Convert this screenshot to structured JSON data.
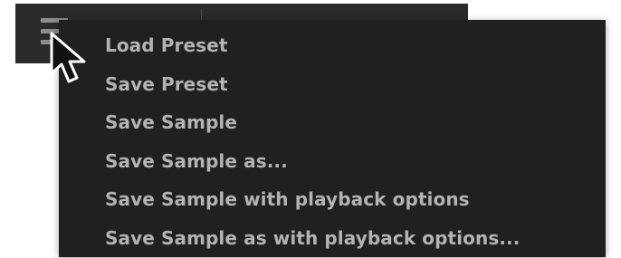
{
  "toolbar": {
    "menu_icon": "hamburger-menu-icon"
  },
  "menu": {
    "items": [
      {
        "label": "Load Preset"
      },
      {
        "label": "Save Preset"
      },
      {
        "label": "Save Sample"
      },
      {
        "label": "Save Sample as..."
      },
      {
        "label": "Save Sample with playback options"
      },
      {
        "label": "Save Sample as with playback options..."
      }
    ]
  },
  "cursor": {
    "icon": "pointer-cursor-icon"
  },
  "colors": {
    "toolbar_bg": "#2b2b2b",
    "menu_bg": "#202020",
    "menu_text": "#b3b3b3",
    "icon_gray": "#8d8d8d"
  }
}
